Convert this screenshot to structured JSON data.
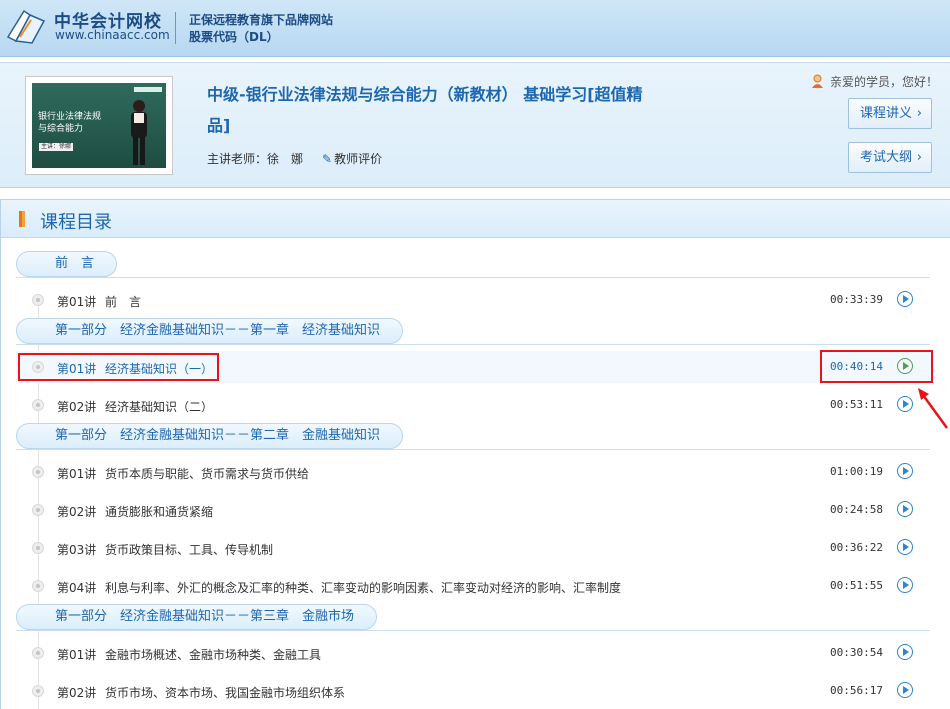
{
  "header": {
    "logo_cn": "中华会计网校",
    "logo_en": "www.chinaacc.com",
    "slogan1": "正保远程教育旗下品牌网站",
    "slogan2": "股票代码（DL）",
    "logo_icon": "book-logo-icon"
  },
  "course": {
    "title": "中级-银行业法律法规与综合能力（新教材） 基础学习[超值精品]",
    "teacher": "主讲老师：徐　娜",
    "evaluate": "教师评价",
    "greeting": "亲爱的学员，您好！",
    "notes_button": "课程讲义",
    "outline_button": "考试大纲",
    "thumbnail": {
      "title": "银行业法律法规与综合能力",
      "tag": "主讲：徐娜"
    }
  },
  "catalog": {
    "title": "课程目录",
    "sections": [
      {
        "title": "前　言",
        "lessons": [
          {
            "no": "第01讲",
            "name": "前　言",
            "duration": "00:33:39"
          }
        ]
      },
      {
        "title": "第一部分　经济金融基础知识－－第一章　经济基础知识",
        "lessons": [
          {
            "no": "第01讲",
            "name": "经济基础知识（一）",
            "duration": "00:40:14"
          },
          {
            "no": "第02讲",
            "name": "经济基础知识（二）",
            "duration": "00:53:11"
          }
        ]
      },
      {
        "title": "第一部分　经济金融基础知识－－第二章　金融基础知识",
        "lessons": [
          {
            "no": "第01讲",
            "name": "货币本质与职能、货币需求与货币供给",
            "duration": "01:00:19"
          },
          {
            "no": "第02讲",
            "name": "通货膨胀和通货紧缩",
            "duration": "00:24:58"
          },
          {
            "no": "第03讲",
            "name": "货币政策目标、工具、传导机制",
            "duration": "00:36:22"
          },
          {
            "no": "第04讲",
            "name": "利息与利率、外汇的概念及汇率的种类、汇率变动的影响因素、汇率变动对经济的影响、汇率制度",
            "duration": "00:51:55"
          }
        ]
      },
      {
        "title": "第一部分　经济金融基础知识－－第三章　金融市场",
        "lessons": [
          {
            "no": "第01讲",
            "name": "金融市场概述、金融市场种类、金融工具",
            "duration": "00:30:54"
          },
          {
            "no": "第02讲",
            "name": "货币市场、资本市场、我国金融市场组织体系",
            "duration": "00:56:17"
          }
        ]
      }
    ]
  },
  "colors": {
    "accent_blue": "#1d67b1",
    "highlight_red": "#e8141b",
    "active_play_green": "#4aa24a"
  }
}
